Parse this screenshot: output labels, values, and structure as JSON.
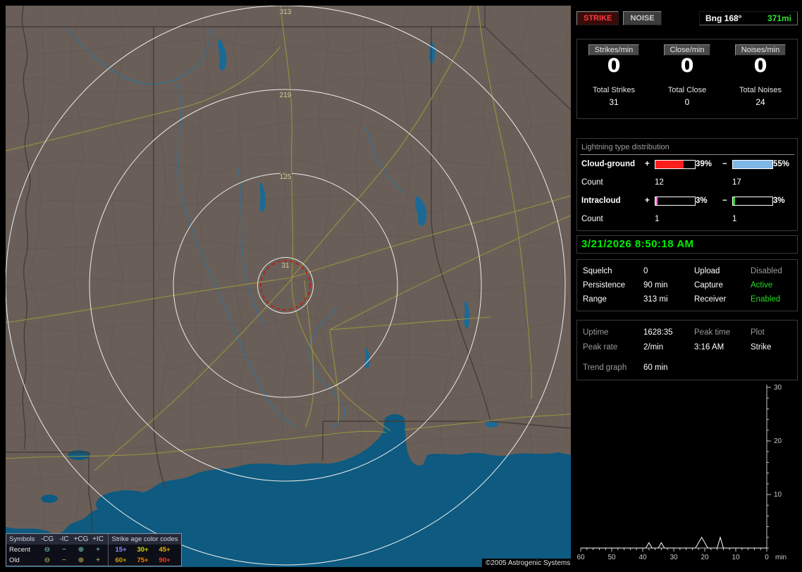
{
  "theme": {
    "accent_green": "#00ee00",
    "strike_red": "#ff3c3c",
    "noise_gray": "#c8c8c8",
    "bearing_green": "#2fe42f"
  },
  "map": {
    "ring_labels": [
      "313",
      "219",
      "125",
      "31"
    ],
    "copyright": "©2005 Astrogenic Systems",
    "legend": {
      "symbols_header": "Symbols",
      "symbol_columns": [
        "-CG",
        "-IC",
        "+CG",
        "+IC"
      ],
      "age_header": "Strike age color codes",
      "rows": [
        {
          "label": "Recent",
          "symbols": [
            "⊖",
            "−",
            "⊕",
            "+"
          ],
          "symbol_color": "#7fdfc8",
          "ages": [
            {
              "label": "15+",
              "color": "#8c8cff"
            },
            {
              "label": "30+",
              "color": "#d8d800"
            },
            {
              "label": "45+",
              "color": "#e8b400"
            }
          ]
        },
        {
          "label": "Old",
          "symbols": [
            "⊖",
            "−",
            "⊕",
            "+"
          ],
          "symbol_color": "#d8c868",
          "ages": [
            {
              "label": "60+",
              "color": "#cfa200"
            },
            {
              "label": "75+",
              "color": "#f28300"
            },
            {
              "label": "90+",
              "color": "#ff3a1a"
            }
          ]
        }
      ]
    }
  },
  "panel": {
    "strike_button": "STRIKE",
    "noise_button": "NOISE",
    "bearing_label": "Bng 168°",
    "bearing_distance": "371mi",
    "rate_counters": [
      {
        "label": "Strikes/min",
        "value": "0",
        "total_label": "Total Strikes",
        "total_value": "31"
      },
      {
        "label": "Close/min",
        "value": "0",
        "total_label": "Total Close",
        "total_value": "0"
      },
      {
        "label": "Noises/min",
        "value": "0",
        "total_label": "Total Noises",
        "total_value": "24"
      }
    ],
    "distribution": {
      "title": "Lightning type distribution",
      "rows": [
        {
          "label": "Cloud-ground",
          "pos_sign": "+",
          "neg_sign": "−",
          "pos": {
            "pct_label": "39%",
            "fill": 39,
            "color": "#ff1e1e"
          },
          "neg": {
            "pct_label": "55%",
            "fill": 55,
            "color": "#7fb6e8"
          },
          "count_label": "Count",
          "pos_count": "12",
          "neg_count": "17"
        },
        {
          "label": "Intracloud",
          "pos_sign": "+",
          "neg_sign": "−",
          "pos": {
            "pct_label": "3%",
            "fill": 3,
            "color": "#ff7fd4"
          },
          "neg": {
            "pct_label": "3%",
            "fill": 3,
            "color": "#2fd42f"
          },
          "count_label": "Count",
          "pos_count": "1",
          "neg_count": "1"
        }
      ]
    },
    "datetime": "3/21/2026 8:50:18 AM",
    "settings": {
      "rows": [
        {
          "l1": "Squelch",
          "v1": "0",
          "l2": "Upload",
          "v2": "Disabled",
          "v2_color": "#9a9a9a"
        },
        {
          "l1": "Persistence",
          "v1": "90 min",
          "l2": "Capture",
          "v2": "Active",
          "v2_color": "#22dd22"
        },
        {
          "l1": "Range",
          "v1": "313 mi",
          "l2": "Receiver",
          "v2": "Enabled",
          "v2_color": "#22dd22"
        }
      ]
    },
    "status": {
      "rows": [
        {
          "l1": "Uptime",
          "v1": "1628:35",
          "h1": "Peak time",
          "h2": "Plot"
        },
        {
          "l1": "Peak rate",
          "v1": "2/min",
          "v2": "3:16 AM",
          "v3": "Strike"
        }
      ],
      "trend_label": "Trend graph",
      "trend_value": "60 min"
    }
  },
  "chart_data": {
    "type": "line",
    "title": "Trend graph",
    "window_label": "60 min",
    "xlabel": "min",
    "x_ticks": [
      60,
      50,
      40,
      30,
      20,
      10,
      0
    ],
    "y_ticks": [
      10,
      20,
      30
    ],
    "xlim": [
      60,
      0
    ],
    "ylim": [
      0,
      30
    ],
    "grid": false,
    "legend_position": "none",
    "series": [
      {
        "name": "Strike",
        "points": [
          [
            60,
            0
          ],
          [
            39,
            0
          ],
          [
            38,
            1
          ],
          [
            37,
            0
          ],
          [
            35,
            0
          ],
          [
            34,
            1
          ],
          [
            33,
            0
          ],
          [
            23,
            0
          ],
          [
            21,
            2
          ],
          [
            19,
            0
          ],
          [
            16,
            0
          ],
          [
            15,
            2
          ],
          [
            14,
            0
          ],
          [
            0,
            0
          ]
        ]
      }
    ]
  }
}
